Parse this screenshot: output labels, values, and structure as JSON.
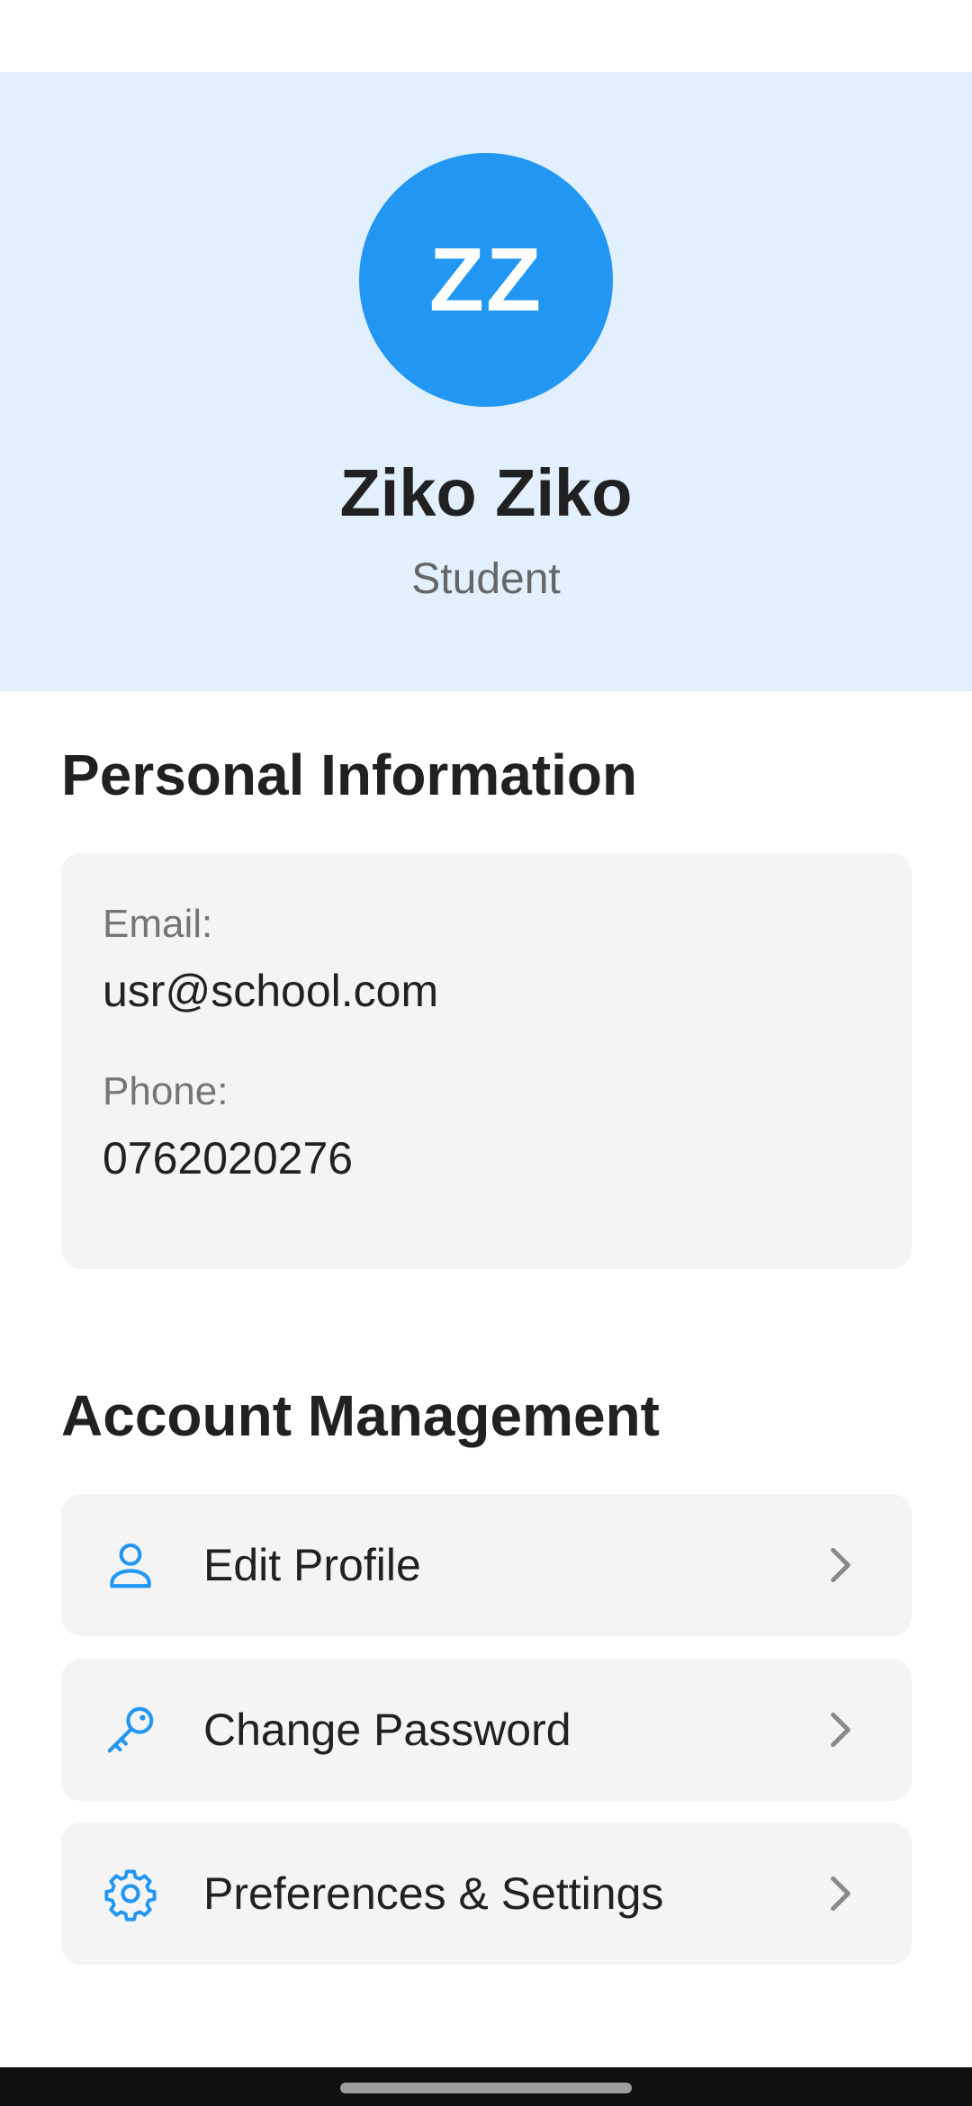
{
  "profile": {
    "initials": "ZZ",
    "name": "Ziko Ziko",
    "role": "Student",
    "avatar_color": "#2196f3",
    "header_bg": "#e1f0fc"
  },
  "personal_info": {
    "title": "Personal Information",
    "email_label": "Email:",
    "email_value": "usr@school.com",
    "phone_label": "Phone:",
    "phone_value": "0762020276"
  },
  "account_management": {
    "title": "Account Management",
    "items": [
      {
        "label": "Edit Profile",
        "icon": "person-icon"
      },
      {
        "label": "Change Password",
        "icon": "key-icon"
      },
      {
        "label": "Preferences & Settings",
        "icon": "gear-icon"
      }
    ]
  },
  "accent_color": "#2196f3"
}
